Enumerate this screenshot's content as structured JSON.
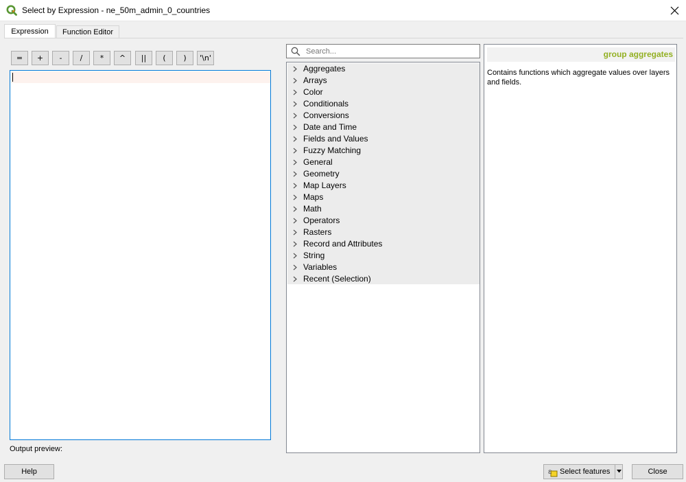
{
  "window": {
    "title": "Select by Expression - ne_50m_admin_0_countries",
    "logo_icon": "qgis-logo-icon",
    "close_icon": "close-icon"
  },
  "tabs": [
    {
      "label": "Expression",
      "active": true
    },
    {
      "label": "Function Editor",
      "active": false
    }
  ],
  "operators": [
    "=",
    "+",
    "-",
    "/",
    "*",
    "^",
    "||",
    "(",
    ")",
    "'\\n'"
  ],
  "editor": {
    "value": "",
    "output_preview_label": "Output preview:"
  },
  "search": {
    "placeholder": "Search...",
    "value": ""
  },
  "function_groups": [
    "Aggregates",
    "Arrays",
    "Color",
    "Conditionals",
    "Conversions",
    "Date and Time",
    "Fields and Values",
    "Fuzzy Matching",
    "General",
    "Geometry",
    "Map Layers",
    "Maps",
    "Math",
    "Operators",
    "Rasters",
    "Record and Attributes",
    "String",
    "Variables",
    "Recent (Selection)"
  ],
  "help": {
    "title": "group aggregates",
    "description": "Contains functions which aggregate values over layers and fields."
  },
  "buttons": {
    "help": "Help",
    "select_features": "Select features",
    "close": "Close"
  },
  "colors": {
    "help_title": "#93b023",
    "editor_border": "#0078d7",
    "tree_group_bg": "#ececec"
  }
}
